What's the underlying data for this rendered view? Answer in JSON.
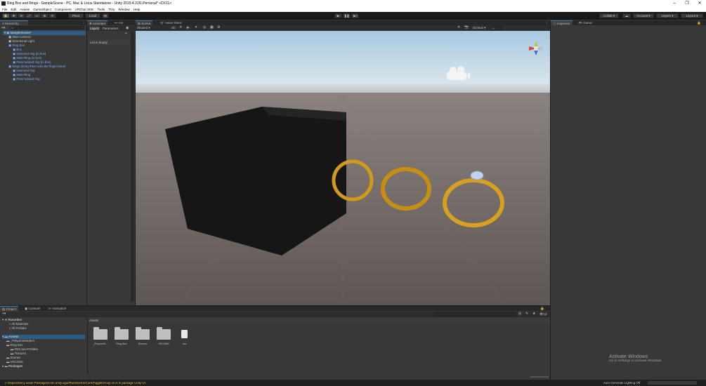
{
  "window": {
    "title": "Ring Box and Rings - SampleScene - PC, Mac & Linux Standalone - Unity 2019.4.31f1 Personal* <DX11>",
    "minimize": "–",
    "maximize": "❐",
    "close": "✕"
  },
  "menu": [
    "File",
    "Edit",
    "Assets",
    "GameObject",
    "Component",
    "VRChat SDK",
    "Tools",
    "Thry",
    "Window",
    "Help"
  ],
  "toolbar": {
    "pivot": "Pivot",
    "local": "Local",
    "play": "▶",
    "pause": "❚❚",
    "step": "▶|",
    "collab": "Collab ▾",
    "account": "Account ▾",
    "layers": "Layers ▾",
    "layout": "Layout ▾"
  },
  "hierarchy": {
    "tab": "Hierarchy",
    "search_placeholder": "All",
    "scene": "SampleScene*",
    "items": [
      {
        "label": "Main Camera",
        "depth": 1,
        "prefab": false
      },
      {
        "label": "Directional Light",
        "depth": 1,
        "prefab": false
      },
      {
        "label": "Ring Box",
        "depth": 1,
        "prefab": true
      },
      {
        "label": "Box",
        "depth": 2,
        "prefab": true
      },
      {
        "label": "Diamond ring (in box)",
        "depth": 2,
        "prefab": true
      },
      {
        "label": "Male Ring (in box)",
        "depth": 2,
        "prefab": true
      },
      {
        "label": "Plain twisted ring (in box)",
        "depth": 2,
        "prefab": true
      },
      {
        "label": "Rings (Drag them onto the finger bone)",
        "depth": 1,
        "prefab": true
      },
      {
        "label": "Diamond ring",
        "depth": 2,
        "prefab": true
      },
      {
        "label": "Male Ring",
        "depth": 2,
        "prefab": true
      },
      {
        "label": "Plain twisted ring",
        "depth": 2,
        "prefab": true
      }
    ]
  },
  "animator": {
    "tabs": [
      "Animator",
      "Ani"
    ],
    "subtabs": [
      "Layers",
      "Parameters"
    ],
    "empty": "List is Empty"
  },
  "scene": {
    "tabs": [
      "Scene",
      "Asset Store"
    ],
    "shading": "Shaded",
    "mode_2d": "2D",
    "gizmos": "Gizmos",
    "search_placeholder": "All"
  },
  "inspector": {
    "tabs": [
      "Inspector",
      "Game"
    ]
  },
  "project": {
    "tabs": [
      "Project",
      "Console",
      "Animation"
    ],
    "count": "13",
    "favorites": "Favorites",
    "fav_items": [
      "All Materials",
      "All Prefabs"
    ],
    "assets_root": "Assets",
    "tree": [
      {
        "label": "_PoiyomiShaders",
        "depth": 1
      },
      {
        "label": "Ring Box",
        "depth": 1
      },
      {
        "label": "FBX and Prefabs",
        "depth": 2
      },
      {
        "label": "Textures",
        "depth": 2
      },
      {
        "label": "Scenes",
        "depth": 1
      },
      {
        "label": "VRCSDK",
        "depth": 1
      }
    ],
    "packages": "Packages",
    "breadcrumb": "Assets",
    "folders": [
      "_PoiyomiS...",
      "Ring Box",
      "Scenes",
      "VRCSDK",
      "csc"
    ]
  },
  "status": {
    "message": "Dependency asset Packages/com.unity.ugui/Runtime/UI/Core/ToggleGroup.cs is in package Unity UI.",
    "lighting": "Auto Generate Lighting Off"
  },
  "watermark": {
    "title": "Activate Windows",
    "subtitle": "Go to Settings to activate Windows."
  },
  "colors": {
    "accent": "#3a79bb",
    "panel": "#383838",
    "prefab_blue": "#7eb0ff",
    "ring_gold": "#d29a1c"
  }
}
